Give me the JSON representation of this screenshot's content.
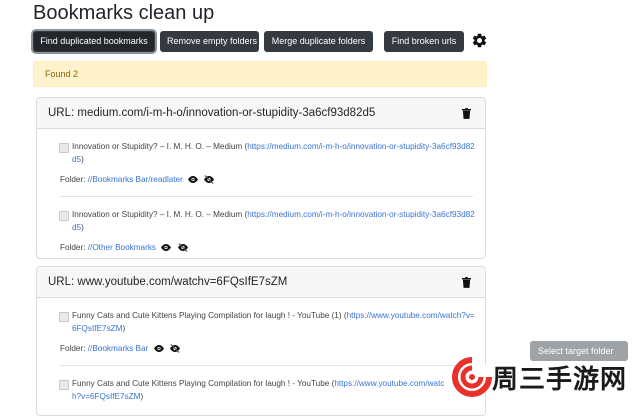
{
  "page": {
    "title": "Bookmarks clean up"
  },
  "toolbar": {
    "find_duplicated": "Find duplicated bookmarks",
    "remove_empty": "Remove empty folders",
    "merge_duplicate": "Merge duplicate folders",
    "find_broken": "Find broken urls",
    "settings_icon": "gear-icon"
  },
  "alert": {
    "text": "Found 2"
  },
  "groups": [
    {
      "header": "URL: medium.com/i-m-h-o/innovation-or-stupidity-3a6cf93d82d5",
      "items": [
        {
          "title": "Innovation or Stupidity? – I. M. H. O. – Medium (",
          "url": "https://medium.com/i-m-h-o/innovation-or-stupidity-3a6cf93d82d5",
          "close": ")",
          "folder_label": "Folder: ",
          "folder": "//Bookmarks Bar/readlater"
        },
        {
          "title": "Innovation or Stupidity? – I. M. H. O. – Medium (",
          "url": "https://medium.com/i-m-h-o/innovation-or-stupidity-3a6cf93d82d5",
          "close": ")",
          "folder_label": "Folder: ",
          "folder": "//Other Bookmarks"
        }
      ]
    },
    {
      "header": "URL: www.youtube.com/watchv=6FQsIfE7sZM",
      "items": [
        {
          "title": "Funny Cats and Cute Kittens Playing Compilation for laugh ! - YouTube (1) (",
          "url": "https://www.youtube.com/watch?v=6FQsIfE7sZM",
          "close": ")",
          "folder_label": "Folder: ",
          "folder": "//Bookmarks Bar"
        },
        {
          "title": "Funny Cats and Cute Kittens Playing Compilation for laugh ! - YouTube (",
          "url": "https://www.youtube.com/watch?v=6FQsIfE7sZM",
          "close": ")"
        }
      ]
    }
  ],
  "side_button": {
    "label": "Select target folder"
  },
  "watermark": {
    "text": "周三手游网"
  },
  "colors": {
    "button": "#343a40",
    "alert_bg": "#fff3cd",
    "link": "#3973d6",
    "watermark_red": "#e8312a"
  }
}
